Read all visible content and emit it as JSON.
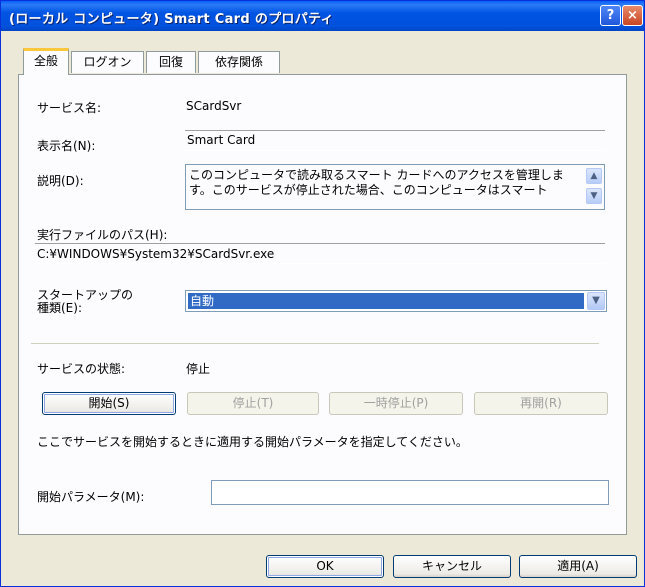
{
  "window": {
    "title": "(ローカル コンピュータ) Smart Card のプロパティ",
    "help_btn": "?",
    "close_btn": "×"
  },
  "tabs": [
    {
      "label": "全般"
    },
    {
      "label": "ログオン"
    },
    {
      "label": "回復"
    },
    {
      "label": "依存関係"
    }
  ],
  "general": {
    "service_name_label": "サービス名:",
    "service_name_value": "SCardSvr",
    "display_name_label": "表示名(N):",
    "display_name_value": "Smart Card",
    "description_label": "説明(D):",
    "description_value": "このコンピュータで読み取るスマート カードへのアクセスを管理します。このサービスが停止された場合、このコンピュータはスマート",
    "exe_path_label": "実行ファイルのパス(H):",
    "exe_path_value": "C:¥WINDOWS¥System32¥SCardSvr.exe",
    "startup_type_label_1": "スタートアップの",
    "startup_type_label_2": "種類(E):",
    "startup_type_value": "自動",
    "status_label": "サービスの状態:",
    "status_value": "停止",
    "start_btn": "開始(S)",
    "stop_btn": "停止(T)",
    "pause_btn": "一時停止(P)",
    "resume_btn": "再開(R)",
    "hint_text": "ここでサービスを開始するときに適用する開始パラメータを指定してください。",
    "start_params_label": "開始パラメータ(M):",
    "start_params_value": ""
  },
  "footer": {
    "ok": "OK",
    "cancel": "キャンセル",
    "apply": "適用(A)"
  },
  "icons": {
    "up": "▲",
    "down": "▼"
  }
}
